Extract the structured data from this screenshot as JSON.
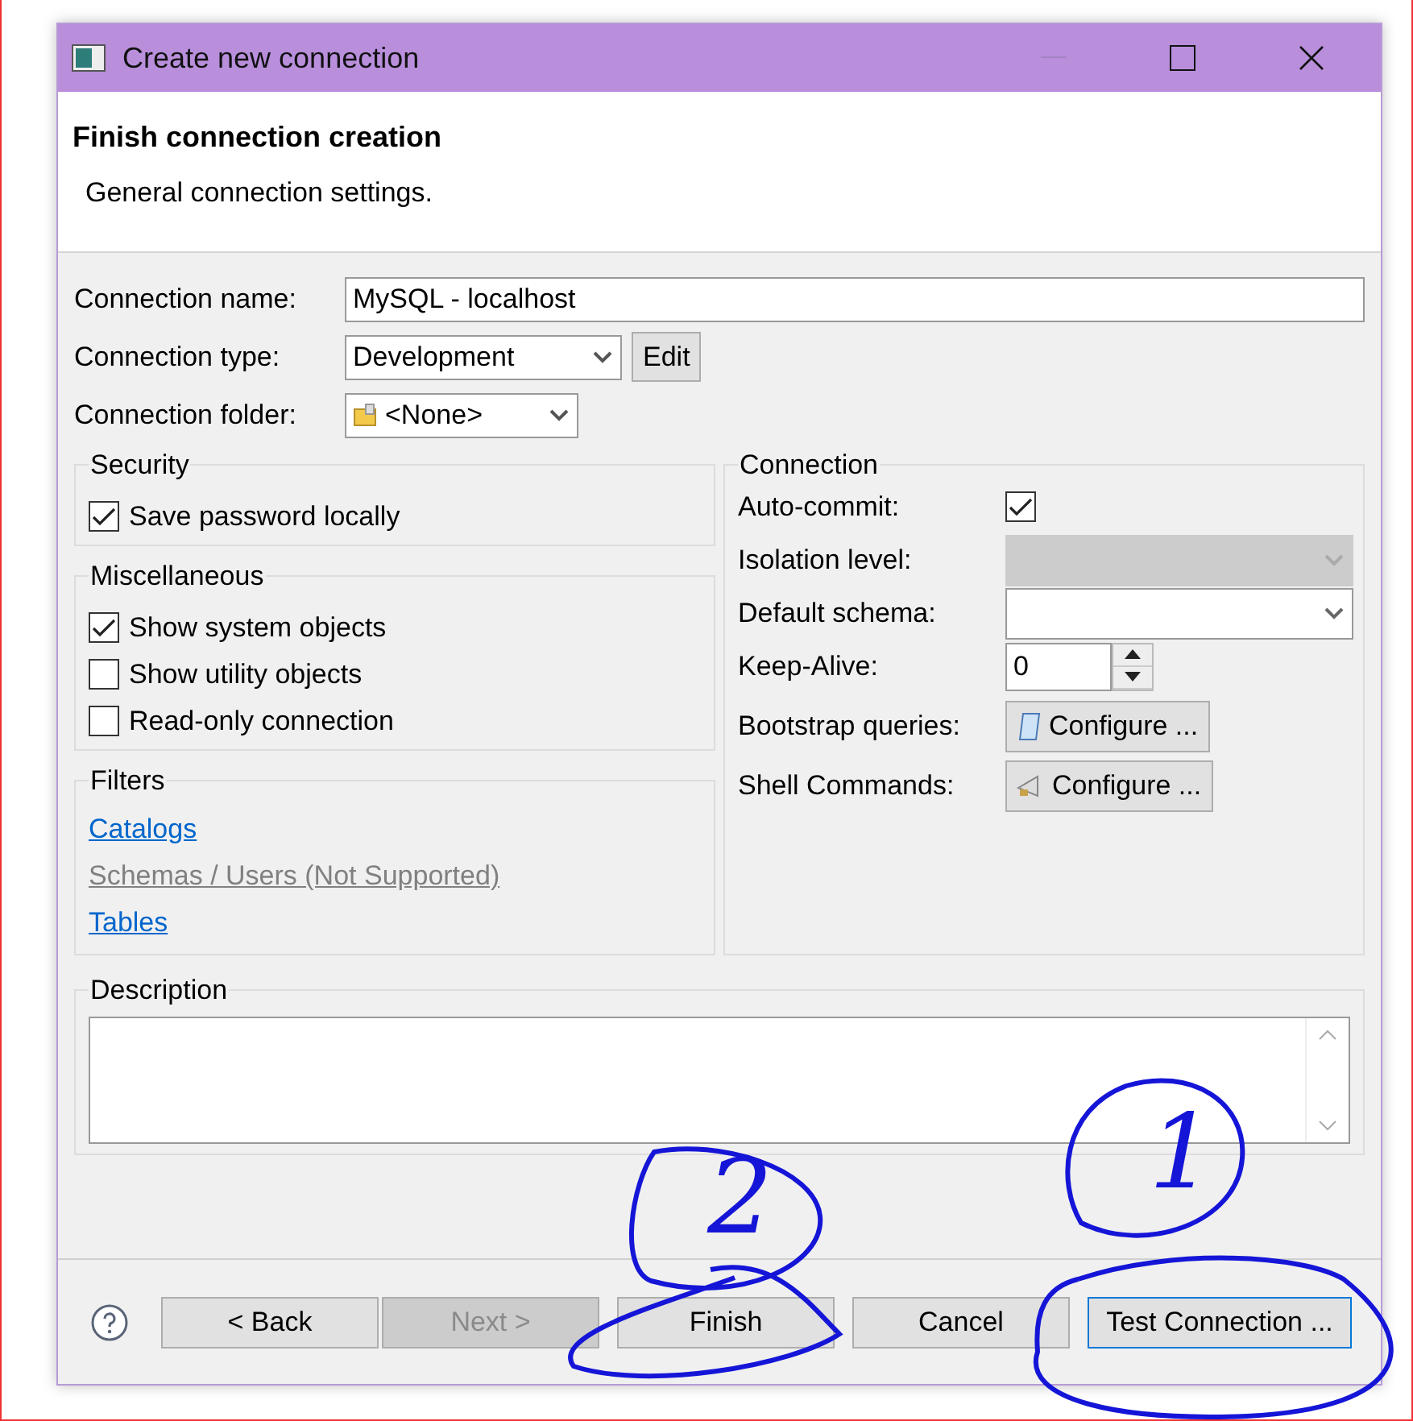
{
  "window": {
    "title": "Create new connection"
  },
  "header": {
    "title": "Finish connection creation",
    "subtitle": "General connection settings."
  },
  "general": [
    {
      "kind": "text",
      "label": "Connection name:",
      "value": "MySQL - localhost"
    },
    {
      "kind": "select",
      "label": "Connection type:",
      "value": "Development",
      "button": "Edit"
    },
    {
      "kind": "folder",
      "label": "Connection folder:",
      "value": "<None>"
    }
  ],
  "groups": [
    {
      "title": "Security",
      "options": [
        {
          "label": "Save password locally",
          "checked": true
        }
      ]
    },
    {
      "title": "Miscellaneous",
      "options": [
        {
          "label": "Show system objects",
          "checked": true
        },
        {
          "label": "Show utility objects",
          "checked": false
        },
        {
          "label": "Read-only connection",
          "checked": false
        }
      ]
    }
  ],
  "filters": {
    "title": "Filters",
    "links": [
      {
        "label": "Catalogs",
        "disabled": false
      },
      {
        "label": "Schemas / Users (Not Supported)",
        "disabled": true
      },
      {
        "label": "Tables",
        "disabled": false
      }
    ]
  },
  "connection": {
    "title": "Connection",
    "rows": [
      {
        "kind": "checkbox",
        "label": "Auto-commit:",
        "checked": true
      },
      {
        "kind": "select",
        "label": "Isolation level:",
        "disabled": true
      },
      {
        "kind": "select",
        "label": "Default schema:",
        "disabled": false
      },
      {
        "kind": "spinner",
        "label": "Keep-Alive:",
        "value": "0"
      },
      {
        "kind": "button",
        "label": "Bootstrap queries:",
        "button": "Configure ..."
      },
      {
        "kind": "button",
        "label": "Shell Commands:",
        "button": "Configure ..."
      }
    ]
  },
  "description": {
    "title": "Description"
  },
  "buttons": [
    {
      "label": "< Back",
      "disabled": false,
      "focused": false
    },
    {
      "label": "Next >",
      "disabled": true,
      "focused": false
    },
    {
      "label": "Finish",
      "disabled": false,
      "focused": false
    },
    {
      "label": "Cancel",
      "disabled": false,
      "focused": false
    },
    {
      "label": "Test Connection ...",
      "disabled": false,
      "focused": true
    }
  ],
  "annotations": [
    {
      "label": "2"
    },
    {
      "label": "1"
    }
  ]
}
